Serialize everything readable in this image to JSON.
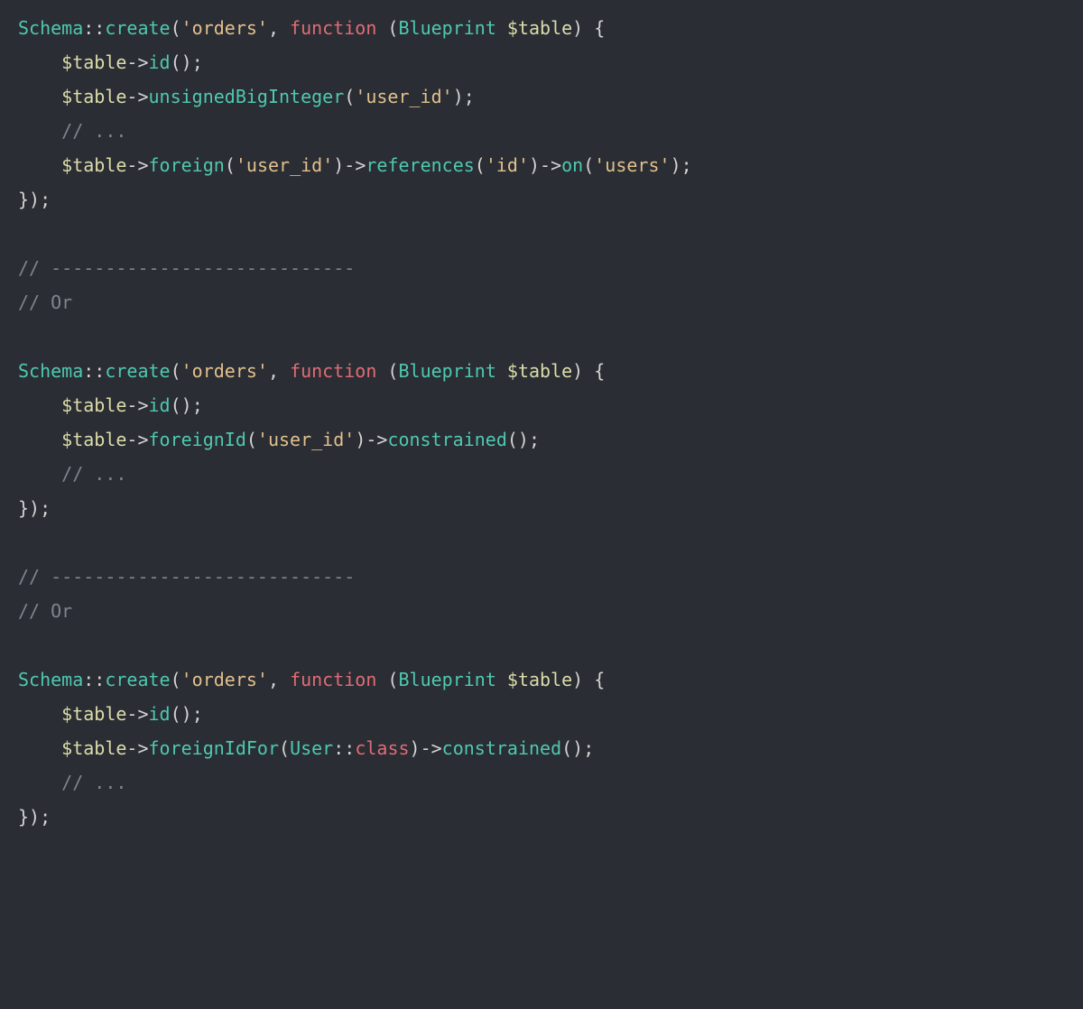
{
  "code": {
    "lines": [
      [
        {
          "t": "Schema",
          "c": "tok-class"
        },
        {
          "t": "::",
          "c": "tok-op"
        },
        {
          "t": "create",
          "c": "tok-method"
        },
        {
          "t": "(",
          "c": "tok-punc"
        },
        {
          "t": "'orders'",
          "c": "tok-string"
        },
        {
          "t": ", ",
          "c": "tok-punc"
        },
        {
          "t": "function",
          "c": "tok-keyword"
        },
        {
          "t": " (",
          "c": "tok-punc"
        },
        {
          "t": "Blueprint",
          "c": "tok-class"
        },
        {
          "t": " ",
          "c": "tok-punc"
        },
        {
          "t": "$table",
          "c": "tok-var"
        },
        {
          "t": ") {",
          "c": "tok-punc"
        }
      ],
      [
        {
          "t": "    ",
          "c": "tok-punc"
        },
        {
          "t": "$table",
          "c": "tok-var"
        },
        {
          "t": "->",
          "c": "tok-arrow"
        },
        {
          "t": "id",
          "c": "tok-method"
        },
        {
          "t": "();",
          "c": "tok-punc"
        }
      ],
      [
        {
          "t": "    ",
          "c": "tok-punc"
        },
        {
          "t": "$table",
          "c": "tok-var"
        },
        {
          "t": "->",
          "c": "tok-arrow"
        },
        {
          "t": "unsignedBigInteger",
          "c": "tok-method"
        },
        {
          "t": "(",
          "c": "tok-punc"
        },
        {
          "t": "'user_id'",
          "c": "tok-string"
        },
        {
          "t": ");",
          "c": "tok-punc"
        }
      ],
      [
        {
          "t": "    ",
          "c": "tok-punc"
        },
        {
          "t": "// ...",
          "c": "tok-comment"
        }
      ],
      [
        {
          "t": "    ",
          "c": "tok-punc"
        },
        {
          "t": "$table",
          "c": "tok-var"
        },
        {
          "t": "->",
          "c": "tok-arrow"
        },
        {
          "t": "foreign",
          "c": "tok-method"
        },
        {
          "t": "(",
          "c": "tok-punc"
        },
        {
          "t": "'user_id'",
          "c": "tok-string"
        },
        {
          "t": ")->",
          "c": "tok-punc"
        },
        {
          "t": "references",
          "c": "tok-method"
        },
        {
          "t": "(",
          "c": "tok-punc"
        },
        {
          "t": "'id'",
          "c": "tok-string"
        },
        {
          "t": ")->",
          "c": "tok-punc"
        },
        {
          "t": "on",
          "c": "tok-method"
        },
        {
          "t": "(",
          "c": "tok-punc"
        },
        {
          "t": "'users'",
          "c": "tok-string"
        },
        {
          "t": ");",
          "c": "tok-punc"
        }
      ],
      [
        {
          "t": "});",
          "c": "tok-punc"
        }
      ],
      [
        {
          "t": "",
          "c": "tok-punc"
        }
      ],
      [
        {
          "t": "// ----------------------------",
          "c": "tok-comment"
        }
      ],
      [
        {
          "t": "// Or",
          "c": "tok-comment"
        }
      ],
      [
        {
          "t": "",
          "c": "tok-punc"
        }
      ],
      [
        {
          "t": "Schema",
          "c": "tok-class"
        },
        {
          "t": "::",
          "c": "tok-op"
        },
        {
          "t": "create",
          "c": "tok-method"
        },
        {
          "t": "(",
          "c": "tok-punc"
        },
        {
          "t": "'orders'",
          "c": "tok-string"
        },
        {
          "t": ", ",
          "c": "tok-punc"
        },
        {
          "t": "function",
          "c": "tok-keyword"
        },
        {
          "t": " (",
          "c": "tok-punc"
        },
        {
          "t": "Blueprint",
          "c": "tok-class"
        },
        {
          "t": " ",
          "c": "tok-punc"
        },
        {
          "t": "$table",
          "c": "tok-var"
        },
        {
          "t": ") {",
          "c": "tok-punc"
        }
      ],
      [
        {
          "t": "    ",
          "c": "tok-punc"
        },
        {
          "t": "$table",
          "c": "tok-var"
        },
        {
          "t": "->",
          "c": "tok-arrow"
        },
        {
          "t": "id",
          "c": "tok-method"
        },
        {
          "t": "();",
          "c": "tok-punc"
        }
      ],
      [
        {
          "t": "    ",
          "c": "tok-punc"
        },
        {
          "t": "$table",
          "c": "tok-var"
        },
        {
          "t": "->",
          "c": "tok-arrow"
        },
        {
          "t": "foreignId",
          "c": "tok-method"
        },
        {
          "t": "(",
          "c": "tok-punc"
        },
        {
          "t": "'user_id'",
          "c": "tok-string"
        },
        {
          "t": ")->",
          "c": "tok-punc"
        },
        {
          "t": "constrained",
          "c": "tok-method"
        },
        {
          "t": "();",
          "c": "tok-punc"
        }
      ],
      [
        {
          "t": "    ",
          "c": "tok-punc"
        },
        {
          "t": "// ...",
          "c": "tok-comment"
        }
      ],
      [
        {
          "t": "});",
          "c": "tok-punc"
        }
      ],
      [
        {
          "t": "",
          "c": "tok-punc"
        }
      ],
      [
        {
          "t": "// ----------------------------",
          "c": "tok-comment"
        }
      ],
      [
        {
          "t": "// Or",
          "c": "tok-comment"
        }
      ],
      [
        {
          "t": "",
          "c": "tok-punc"
        }
      ],
      [
        {
          "t": "Schema",
          "c": "tok-class"
        },
        {
          "t": "::",
          "c": "tok-op"
        },
        {
          "t": "create",
          "c": "tok-method"
        },
        {
          "t": "(",
          "c": "tok-punc"
        },
        {
          "t": "'orders'",
          "c": "tok-string"
        },
        {
          "t": ", ",
          "c": "tok-punc"
        },
        {
          "t": "function",
          "c": "tok-keyword"
        },
        {
          "t": " (",
          "c": "tok-punc"
        },
        {
          "t": "Blueprint",
          "c": "tok-class"
        },
        {
          "t": " ",
          "c": "tok-punc"
        },
        {
          "t": "$table",
          "c": "tok-var"
        },
        {
          "t": ") {",
          "c": "tok-punc"
        }
      ],
      [
        {
          "t": "    ",
          "c": "tok-punc"
        },
        {
          "t": "$table",
          "c": "tok-var"
        },
        {
          "t": "->",
          "c": "tok-arrow"
        },
        {
          "t": "id",
          "c": "tok-method"
        },
        {
          "t": "();",
          "c": "tok-punc"
        }
      ],
      [
        {
          "t": "    ",
          "c": "tok-punc"
        },
        {
          "t": "$table",
          "c": "tok-var"
        },
        {
          "t": "->",
          "c": "tok-arrow"
        },
        {
          "t": "foreignIdFor",
          "c": "tok-method"
        },
        {
          "t": "(",
          "c": "tok-punc"
        },
        {
          "t": "User",
          "c": "tok-class"
        },
        {
          "t": "::",
          "c": "tok-op"
        },
        {
          "t": "class",
          "c": "tok-keyword"
        },
        {
          "t": ")->",
          "c": "tok-punc"
        },
        {
          "t": "constrained",
          "c": "tok-method"
        },
        {
          "t": "();",
          "c": "tok-punc"
        }
      ],
      [
        {
          "t": "    ",
          "c": "tok-punc"
        },
        {
          "t": "// ...",
          "c": "tok-comment"
        }
      ],
      [
        {
          "t": "});",
          "c": "tok-punc"
        }
      ]
    ]
  }
}
